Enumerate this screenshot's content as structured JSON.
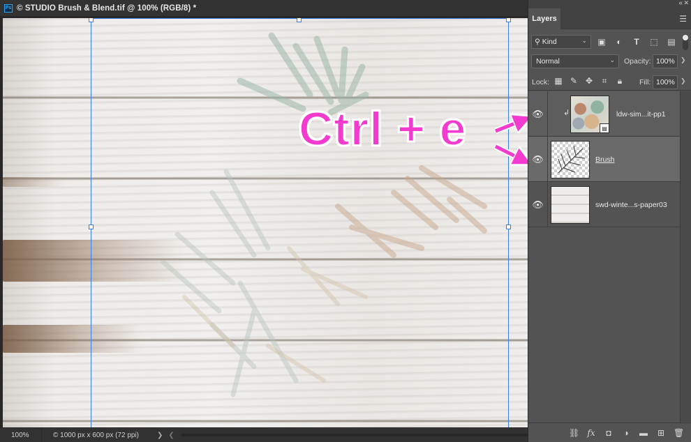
{
  "document": {
    "app_badge": "Ps",
    "title": "© STUDIO Brush & Blend.tif @ 100% (RGB/8) *"
  },
  "status_bar": {
    "zoom": "100%",
    "doc_info": "© 1000 px x 600 px (72 ppi)",
    "arrow": "❯",
    "arrow_left": "❮"
  },
  "panel": {
    "tab_title": "Layers",
    "filter": {
      "kind_label": "Kind"
    },
    "blend": {
      "mode": "Normal",
      "opacity_label": "Opacity:",
      "opacity_value": "100%"
    },
    "lock": {
      "label": "Lock:",
      "fill_label": "Fill:",
      "fill_value": "100%"
    },
    "layers": [
      {
        "name": "ldw-sim...it-pp1",
        "visible": true,
        "clipped": true,
        "smart_object": true
      },
      {
        "name": "Brush",
        "visible": true,
        "selected": true
      },
      {
        "name": "swd-winte...s-paper03",
        "visible": true
      }
    ]
  },
  "annotation": {
    "text": "Ctrl + e",
    "color": "#f33bd0"
  },
  "colors": {
    "guide": "#3b7ee8",
    "panel_bg": "#535353",
    "selected_layer": "#6a6a6a"
  }
}
